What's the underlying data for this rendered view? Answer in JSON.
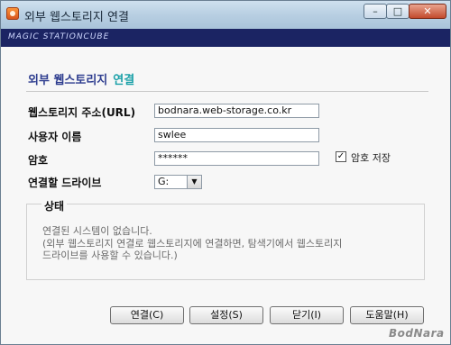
{
  "window": {
    "title": "외부 웹스토리지 연결",
    "minimize_glyph": "–",
    "maximize_glyph": "□",
    "close_glyph": "✕"
  },
  "brand": {
    "logo_text": "MAGIC STATIONCUBE"
  },
  "heading": {
    "prefix": "외부 웹스토리지",
    "accent": "연결",
    "accent_color": "#19a0a8"
  },
  "form": {
    "address_label": "웹스토리지 주소(URL)",
    "address_value": "bodnara.web-storage.co.kr",
    "username_label": "사용자 이름",
    "username_value": "swlee",
    "password_label": "암호",
    "password_value": "******",
    "save_password_label": "암호 저장",
    "save_password_checked": true,
    "drive_label": "연결할 드라이브",
    "drive_value": "G:"
  },
  "status": {
    "title": "상태",
    "line1": "연결된 시스템이 없습니다.",
    "line2": "(외부 웹스토리지 연결로 웹스토리지에 연결하면, 탐색기에서 웹스토리지",
    "line3": "드라이브를 사용할 수 있습니다.)"
  },
  "buttons": {
    "connect": "연결(C)",
    "settings": "설정(S)",
    "close": "닫기(I)",
    "help": "도움말(H)"
  },
  "watermark": "BodNara"
}
